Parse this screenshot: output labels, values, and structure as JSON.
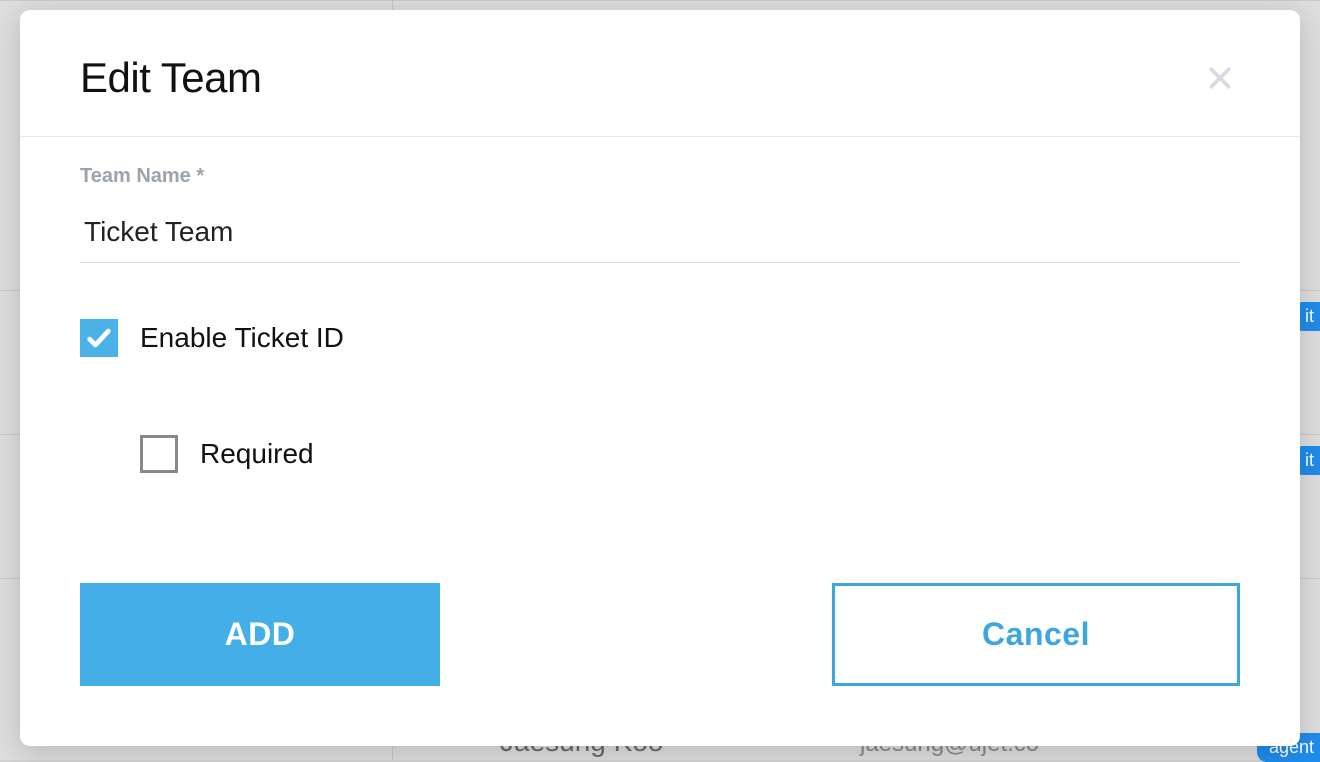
{
  "modal": {
    "title": "Edit Team",
    "field_label": "Team Name *",
    "team_name_value": "Ticket Team",
    "enable_ticket_label": "Enable Ticket ID",
    "enable_ticket_checked": true,
    "required_label": "Required",
    "required_checked": false,
    "add_button": "ADD",
    "cancel_button": "Cancel"
  },
  "background": {
    "row_name": "Jaesung Koo",
    "row_email": "jaesung@ujet.co",
    "badge1": "it",
    "badge2": "it",
    "badge3": "agent"
  }
}
